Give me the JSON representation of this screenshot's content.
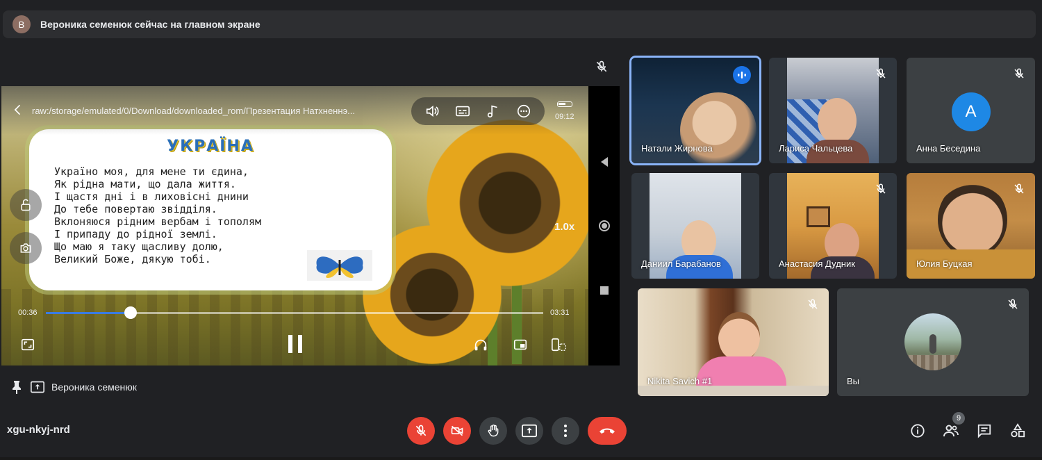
{
  "banner": {
    "avatar_letter": "В",
    "text": "Вероника семенюк сейчас на главном экране"
  },
  "presentation": {
    "file_path": "raw:/storage/emulated/0/Download/downloaded_rom/Презентация Натхненнэ...",
    "clock": "09:12",
    "speed": "1.0x",
    "time_elapsed": "00:36",
    "time_total": "03:31",
    "progress_fraction": 0.17,
    "slide_title": "УКРАЇНА",
    "poem_lines": [
      "Україно моя, для мене ти єдина,",
      "Як рідна мати, що дала життя.",
      "І щастя дні і в лиховісні днини",
      "До тебе повертаю звідділя.",
      "Вклоняюся рідним вербам і тополям",
      "І припаду до рідної землі.",
      "Що маю я таку щасливу долю,",
      "Великий Боже, дякую тобі."
    ]
  },
  "presenter": {
    "name": "Вероника семенюк"
  },
  "participants": [
    {
      "name": "Натали Жирнова",
      "state": "speaking"
    },
    {
      "name": "Лариса Чальцева",
      "state": "muted"
    },
    {
      "name": "Анна Беседина",
      "state": "muted",
      "avatar_letter": "А"
    },
    {
      "name": "Даниил Барабанов",
      "state": "unmuted"
    },
    {
      "name": "Анастасия Дудник",
      "state": "muted"
    },
    {
      "name": "Юлия Буцкая",
      "state": "muted"
    },
    {
      "name": "Nikita Savich #1",
      "state": "muted"
    },
    {
      "name": "Вы",
      "state": "muted"
    }
  ],
  "bottom_bar": {
    "meeting_code": "xgu-nkyj-nrd",
    "participant_count": "9"
  },
  "colors": {
    "background": "#202124",
    "danger": "#ea4335",
    "control_gray": "#3c4043",
    "accent_blue": "#8ab4f8"
  }
}
